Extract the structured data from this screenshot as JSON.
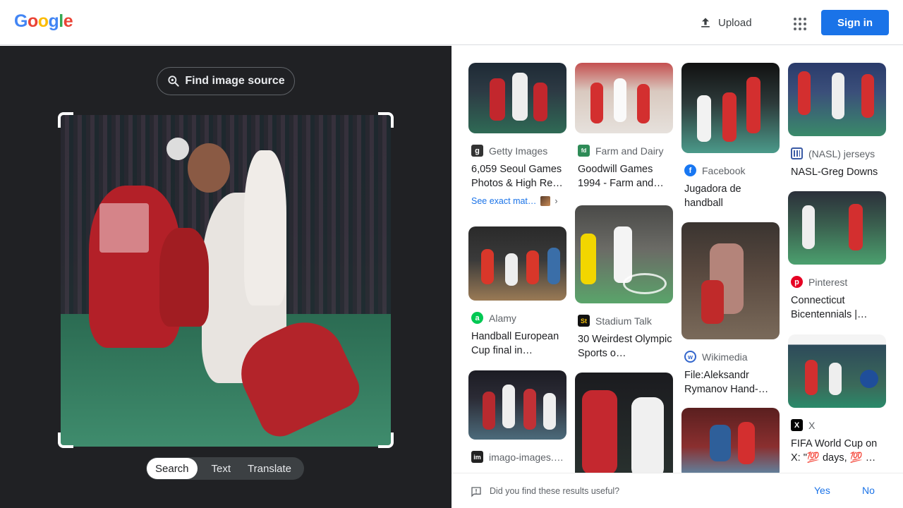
{
  "header": {
    "logo_letters": [
      "G",
      "o",
      "o",
      "g",
      "l",
      "e"
    ],
    "logo_colors": [
      "#4285F4",
      "#EA4335",
      "#FBBC05",
      "#4285F4",
      "#34A853",
      "#EA4335"
    ],
    "upload_label": "Upload",
    "upload_icon": "upload-icon",
    "apps_icon": "apps-grid-icon",
    "signin_label": "Sign in"
  },
  "left_panel": {
    "find_source_label": "Find image source",
    "find_source_icon": "lens-search-icon",
    "modes": [
      "Search",
      "Text",
      "Translate"
    ],
    "active_mode": "Search"
  },
  "results": [
    {
      "source": "Getty Images",
      "favicon": "g",
      "favicon_color": "#333333",
      "title": "6,059 Seoul Games Photos & High Re…",
      "exact_match": "See exact mat…"
    },
    {
      "source": "Farm and Dairy",
      "favicon": "fd",
      "favicon_color": "#2e8b57",
      "title": "Goodwill Games 1994 - Farm and…"
    },
    {
      "source": "Facebook",
      "favicon": "f",
      "favicon_color": "#1877f2",
      "title": "Jugadora de handball"
    },
    {
      "source": "(NASL) jerseys",
      "favicon": "grid",
      "favicon_color": "#3b5ba5",
      "title": "NASL-Greg Downs"
    },
    {
      "source": "Alamy",
      "favicon": "a",
      "favicon_color": "#00c853",
      "title": "Handball European Cup final in…"
    },
    {
      "source": "Stadium Talk",
      "favicon": "St",
      "favicon_color": "#111111",
      "title": "30 Weirdest Olympic Sports o…"
    },
    {
      "source": "Wikimedia",
      "favicon": "w",
      "favicon_color": "#3366cc",
      "title": "File:Aleksandr Rymanov Hand-…"
    },
    {
      "source": "Pinterest",
      "favicon": "p",
      "favicon_color": "#e60023",
      "title": "Connecticut Bicentennials |…"
    },
    {
      "source": "imago-images.…",
      "favicon": "im",
      "favicon_color": "#222222",
      "title": ""
    },
    {
      "source": "X",
      "favicon": "X",
      "favicon_color": "#000000",
      "title": "FIFA World Cup on X: \"💯 days, 💯 …"
    }
  ],
  "feedback": {
    "question": "Did you find these results useful?",
    "yes": "Yes",
    "no": "No"
  }
}
